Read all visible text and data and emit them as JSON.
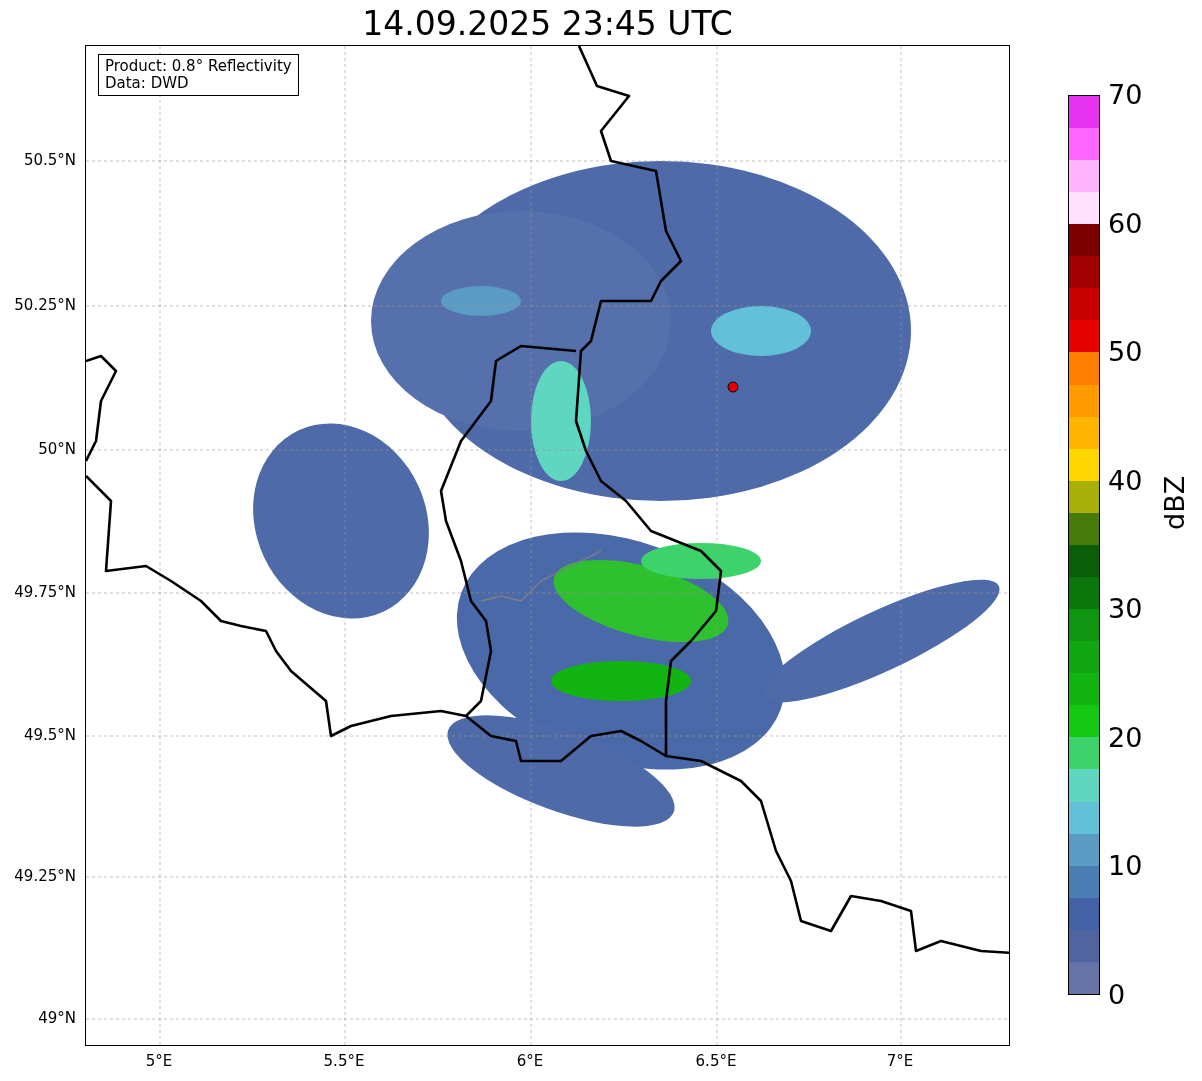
{
  "title": "14.09.2025 23:45 UTC",
  "info_box": [
    "Product: 0.8° Reflectivity",
    "Data: DWD"
  ],
  "latitude_ticks": [
    "50.5°N",
    "50.25°N",
    "50°N",
    "49.75°N",
    "49.5°N",
    "49.25°N",
    "49°N"
  ],
  "longitude_ticks": [
    "5°E",
    "5.5°E",
    "6°E",
    "6.5°E",
    "7°E"
  ],
  "colorbar": {
    "label": "dBZ",
    "ticks": [
      "70",
      "60",
      "50",
      "40",
      "30",
      "20",
      "10",
      "0"
    ]
  }
}
